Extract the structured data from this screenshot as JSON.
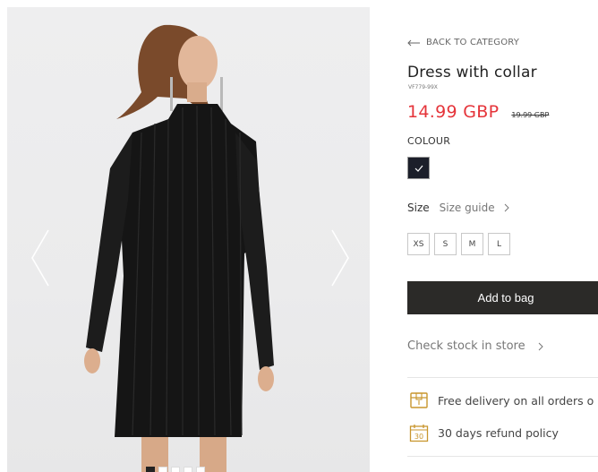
{
  "navigation": {
    "back_label": "BACK TO CATEGORY"
  },
  "product": {
    "name": "Dress with collar",
    "sku": "VF779-99X",
    "price": "14.99 GBP",
    "old_price": "19.99 GBP",
    "colour_label": "COLOUR",
    "selected_colour": "#1c1f2a",
    "size_label": "Size",
    "size_guide_label": "Size guide",
    "sizes": [
      "XS",
      "S",
      "M",
      "L"
    ],
    "add_to_bag_label": "Add to bag",
    "check_stock_label": "Check stock in store"
  },
  "benefits": {
    "delivery": "Free delivery on all orders o",
    "refund": "30 days refund policy",
    "refund_icon_number": "30"
  },
  "gallery": {
    "image_count": 5,
    "active_index": 0
  },
  "colors": {
    "price_red": "#e5343a",
    "button_dark": "#2b2a28",
    "accent_gold": "#c8962e"
  }
}
